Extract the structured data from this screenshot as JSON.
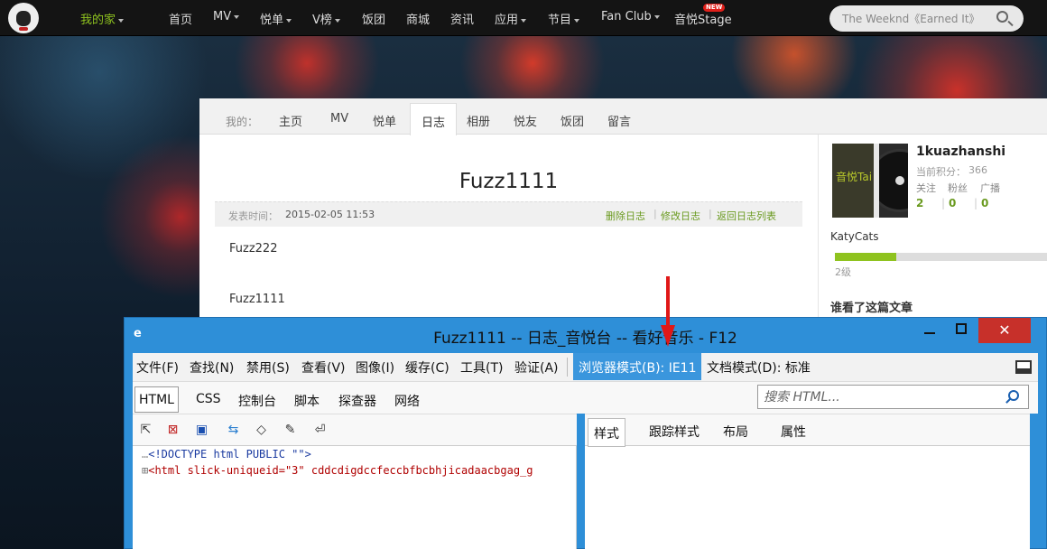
{
  "top_nav": {
    "home": "我的家",
    "items": [
      "首页",
      "MV",
      "悦单",
      "V榜",
      "饭团",
      "商城",
      "资讯",
      "应用",
      "节目",
      "Fan Club",
      "音悦Stage"
    ],
    "new_badge": "NEW",
    "search_placeholder": "The Weeknd《Earned It》"
  },
  "page_tabs": {
    "label": "我的：",
    "items": [
      "主页",
      "MV",
      "悦单",
      "日志",
      "相册",
      "悦友",
      "饭团",
      "留言"
    ],
    "selected": "日志"
  },
  "article": {
    "title": "Fuzz1111",
    "published_label": "发表时间：",
    "published_value": "2015-02-05 11:53",
    "actions": [
      "删除日志",
      "修改日志",
      "返回日志列表"
    ],
    "paragraphs": [
      "Fuzz222",
      "Fuzz1111"
    ]
  },
  "profile": {
    "username": "1kuazhanshi",
    "points_label": "当前积分：",
    "points_value": "366",
    "stat_labels": [
      "关注",
      "粉丝",
      "广播"
    ],
    "stat_values": [
      "2",
      "0",
      "0"
    ],
    "avatar_text": "音悦Tai",
    "nickname": "KatyCats",
    "level": "2级",
    "level_progress": 0.29,
    "who_read": "谁看了这篇文章"
  },
  "devtools": {
    "title": "Fuzz1111 -- 日志_音悦台 -- 看好音乐 - F12",
    "window_buttons": {
      "close": "✕"
    },
    "menu": [
      "文件(F)",
      "查找(N)",
      "禁用(S)",
      "查看(V)",
      "图像(I)",
      "缓存(C)",
      "工具(T)",
      "验证(A)"
    ],
    "browser_mode": "浏览器模式(B): IE11",
    "doc_mode": "文档模式(D): 标准",
    "tabs": [
      "HTML",
      "CSS",
      "控制台",
      "脚本",
      "探查器",
      "网络"
    ],
    "selected_tab": "HTML",
    "search_placeholder": "搜索 HTML...",
    "toolbar_icons": [
      "select-arrow-icon",
      "clear-icon",
      "save-icon",
      "refresh-icon",
      "dom-icon",
      "edit-icon",
      "word-wrap-icon"
    ],
    "code_lines": [
      {
        "prefix": "…",
        "text": "<!DOCTYPE html PUBLIC \"\">"
      },
      {
        "prefix": "⊞",
        "text": "<html slick-uniqueid=\"3\" cddcdigdccfeccbfbcbhjicadaacbgag_g"
      }
    ],
    "right_tabs": [
      "样式",
      "跟踪样式",
      "布局",
      "属性"
    ],
    "right_selected": "样式"
  },
  "colors": {
    "accent_green": "#8fc31f",
    "devtools_blue": "#2e8fd8",
    "close_red": "#c7302a",
    "arrow_red": "#e01818"
  }
}
